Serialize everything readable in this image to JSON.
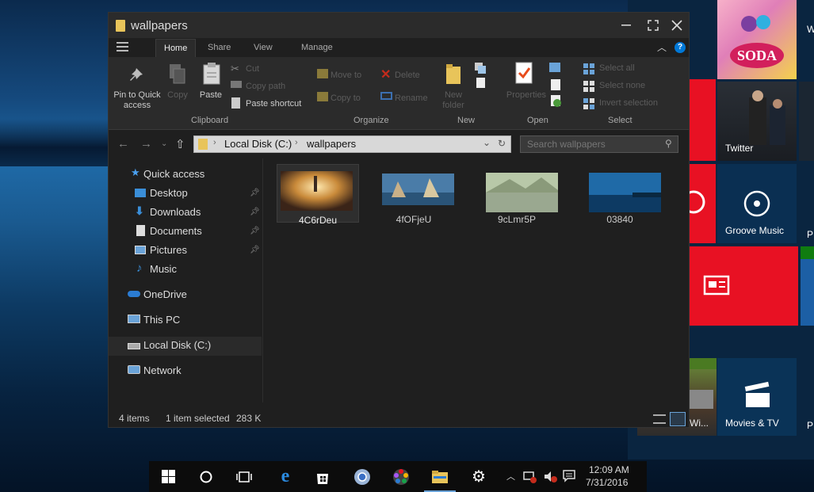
{
  "window": {
    "title": "wallpapers",
    "tabs": [
      "Home",
      "Share",
      "View",
      "Manage"
    ],
    "active_tab": "Home"
  },
  "ribbon": {
    "clipboard": {
      "label": "Clipboard",
      "pin": "Pin to Quick access",
      "copy": "Copy",
      "paste": "Paste",
      "cut": "Cut",
      "copy_path": "Copy path",
      "paste_shortcut": "Paste shortcut"
    },
    "organize": {
      "label": "Organize",
      "move_to": "Move to",
      "copy_to": "Copy to",
      "delete": "Delete",
      "rename": "Rename"
    },
    "new": {
      "label": "New",
      "new_folder": "New folder"
    },
    "open": {
      "label": "Open",
      "properties": "Properties"
    },
    "select": {
      "label": "Select",
      "select_all": "Select all",
      "select_none": "Select none",
      "invert_selection": "Invert selection"
    }
  },
  "address": {
    "segments": [
      "Local Disk (C:)",
      "wallpapers"
    ],
    "search_placeholder": "Search wallpapers"
  },
  "nav": {
    "quick_access": "Quick access",
    "desktop": "Desktop",
    "downloads": "Downloads",
    "documents": "Documents",
    "pictures": "Pictures",
    "music": "Music",
    "onedrive": "OneDrive",
    "this_pc": "This PC",
    "local_disk": "Local Disk (C:)",
    "network": "Network"
  },
  "files": [
    {
      "name": "4C6rDeu",
      "selected": true
    },
    {
      "name": "4fOFjeU",
      "selected": false
    },
    {
      "name": "9cLmr5P",
      "selected": false
    },
    {
      "name": "03840",
      "selected": false
    }
  ],
  "status": {
    "items": "4 items",
    "selected": "1 item selected",
    "size": "283 K"
  },
  "tiles": {
    "twitter": "Twitter",
    "groove": "Groove Music",
    "minecraft": "Minecraft: Wi...",
    "movies": "Movies & TV",
    "w_partial": "W",
    "p1": "P",
    "p2": "P"
  },
  "tray": {
    "time": "12:09 AM",
    "date": "7/31/2016"
  },
  "colors": {
    "window_bg": "#1f1f1f",
    "ribbon_bg": "#2b2b2b",
    "tile_red": "#e81123",
    "accent_blue": "#0078d7",
    "folder_yellow": "#e8c45a"
  }
}
